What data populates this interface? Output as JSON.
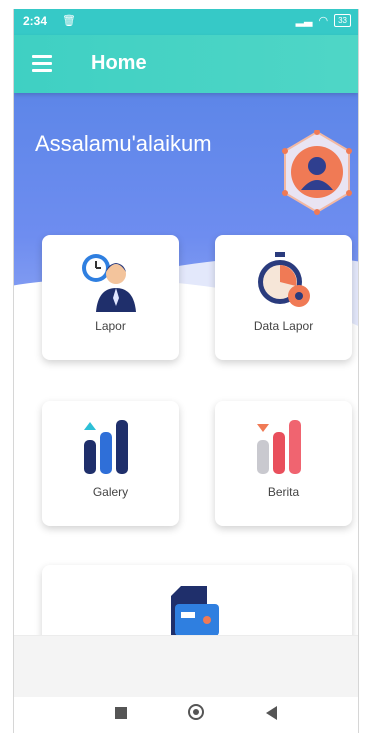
{
  "status_bar": {
    "time": "2:34",
    "battery": "33"
  },
  "app_bar": {
    "title": "Home"
  },
  "hero": {
    "greeting": "Assalamu'alaikum"
  },
  "menu": [
    {
      "label": "Lapor"
    },
    {
      "label": "Data Lapor"
    },
    {
      "label": "Galery"
    },
    {
      "label": "Berita"
    },
    {
      "label": ""
    }
  ],
  "colors": {
    "teal": "#3fd0c3",
    "hero_blue": "#5d86e8",
    "accent_orange": "#f07a55"
  }
}
